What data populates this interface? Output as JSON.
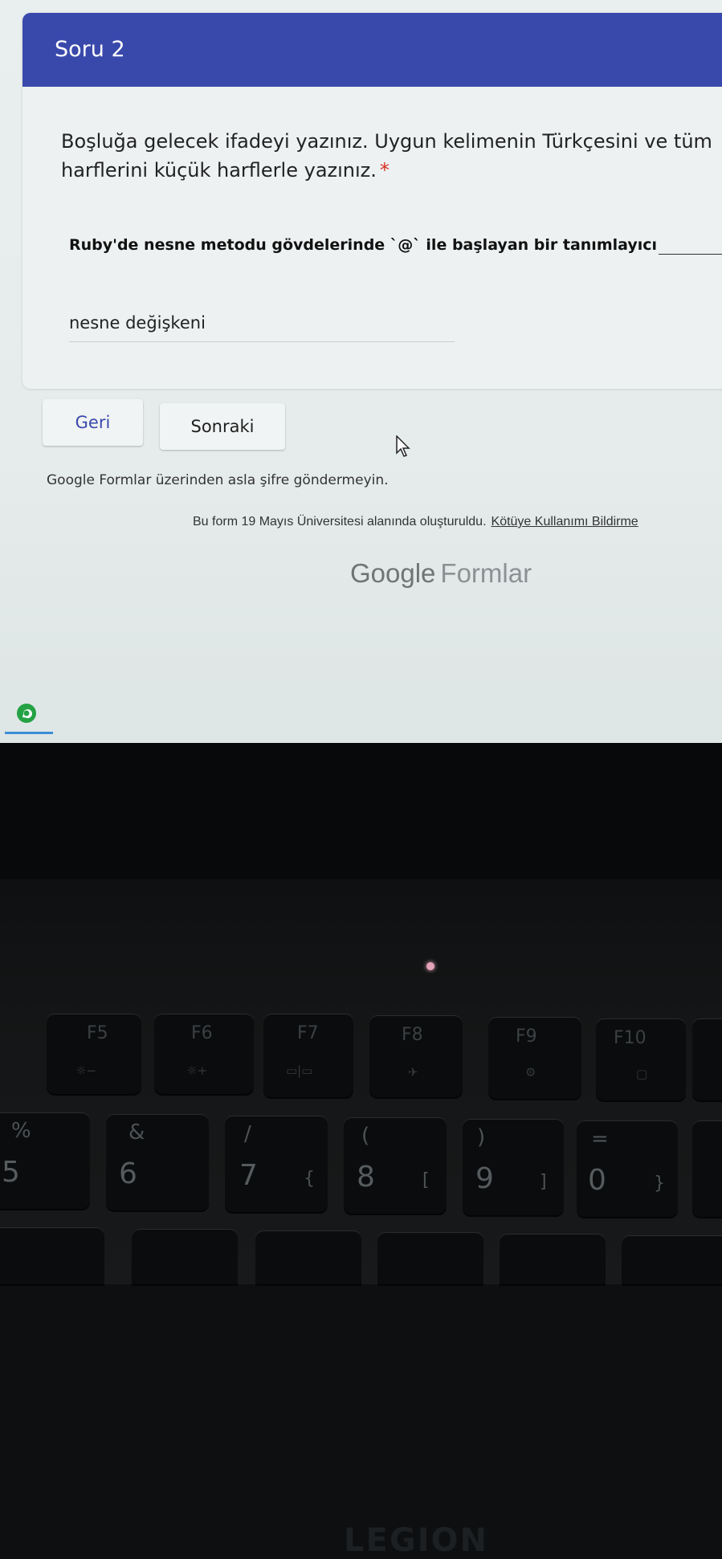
{
  "form": {
    "section_title": "Soru 2",
    "question_title": "Boşluğa gelecek ifadeyi yazınız. Uygun kelimenin Türkçesini ve tüm harflerini küçük harflerle yazınız.",
    "required_mark": "*",
    "question_description": "Ruby'de nesne metodu gövdelerinde `@` ile başlayan bir tanımlayıcı",
    "answer_value": "nesne değişkeni",
    "back_label": "Geri",
    "next_label": "Sonraki",
    "password_warning": "Google Formlar üzerinden asla şifre göndermeyin.",
    "footer_text": "Bu form 19 Mayıs Üniversitesi alanında oluşturuldu.",
    "report_link": "Kötüye Kullanımı Bildirme",
    "brand_google": "Google",
    "brand_forms": "Formlar"
  },
  "colors": {
    "header": "#3949ab",
    "required": "#d93025",
    "card": "#edf1f1"
  },
  "taskbar": {
    "app_icon": "whatsapp-icon"
  },
  "laptop": {
    "logo": "LEGION",
    "fn_keys": [
      {
        "label": "F5",
        "icon": "☼−"
      },
      {
        "label": "F6",
        "icon": "☼+"
      },
      {
        "label": "F7",
        "icon": "▭|▭"
      },
      {
        "label": "F8",
        "icon": "✈"
      },
      {
        "label": "F9",
        "icon": "⚙"
      },
      {
        "label": "F10",
        "icon": "▢"
      }
    ],
    "num_keys": [
      {
        "num": "5",
        "sym": "%",
        "alt": ""
      },
      {
        "num": "6",
        "sym": "&",
        "alt": ""
      },
      {
        "num": "7",
        "sym": "/",
        "alt": "{"
      },
      {
        "num": "8",
        "sym": "(",
        "alt": "["
      },
      {
        "num": "9",
        "sym": ")",
        "alt": "]"
      },
      {
        "num": "0",
        "sym": "=",
        "alt": "}"
      }
    ]
  }
}
